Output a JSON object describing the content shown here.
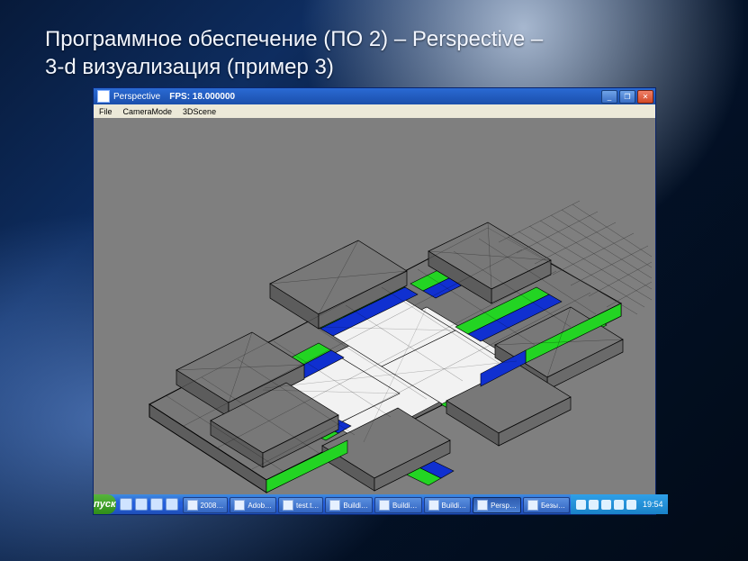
{
  "slide": {
    "title_line1": "Программное обеспечение (ПО 2) – Perspective –",
    "title_line2": "3-d визуализация (пример 3)"
  },
  "window": {
    "app_name": "Perspective",
    "fps_label": "FPS: 18.000000",
    "menu": {
      "file": "File",
      "camera": "CameraMode",
      "scene": "3DScene"
    },
    "buttons": {
      "min": "_",
      "max": "❐",
      "close": "✕"
    }
  },
  "taskbar": {
    "start": "пуск",
    "items": [
      {
        "label": "2008…"
      },
      {
        "label": "Adob…"
      },
      {
        "label": "test.t…"
      },
      {
        "label": "Buildi…"
      },
      {
        "label": "Buildi…"
      },
      {
        "label": "Buildi…"
      },
      {
        "label": "Persp…",
        "active": true
      },
      {
        "label": "Безы…"
      }
    ],
    "clock": "19:54"
  }
}
